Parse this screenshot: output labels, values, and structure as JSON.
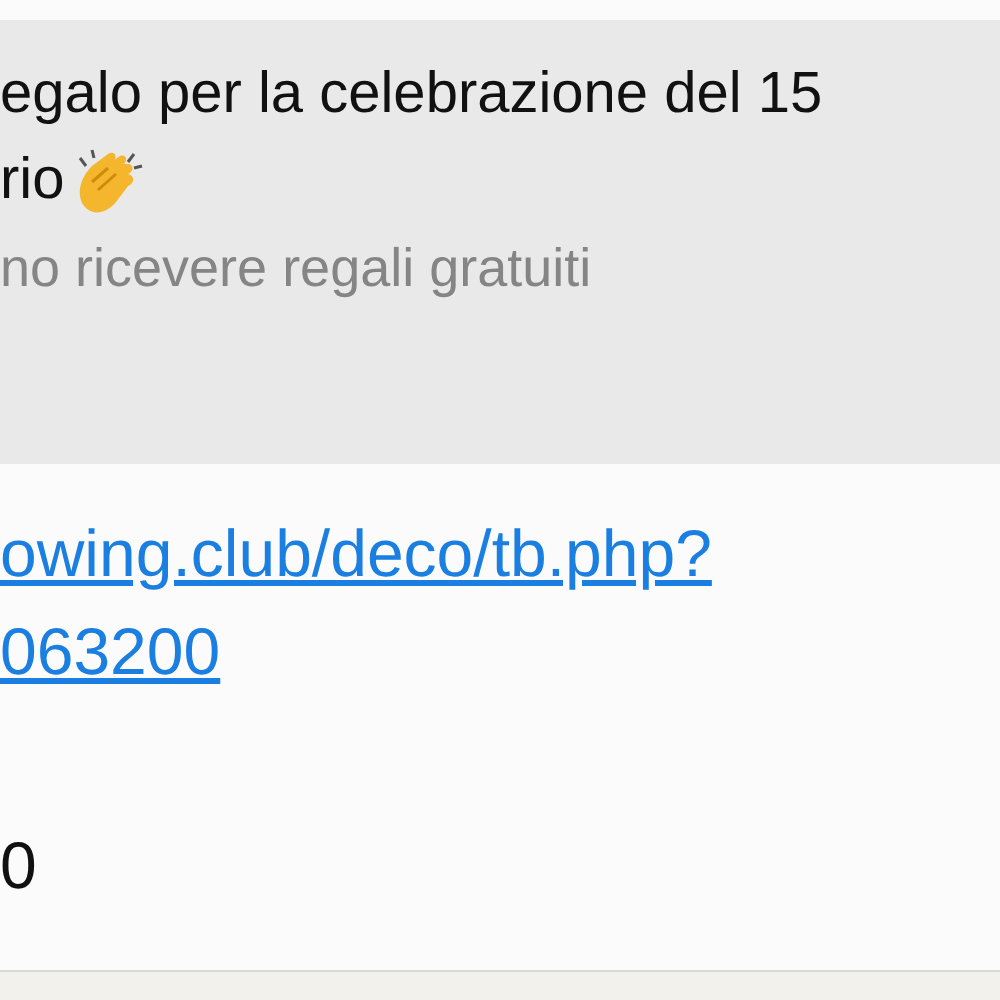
{
  "link_preview": {
    "title_lines": [
      "egalo per la celebrazione del 15",
      "rio"
    ],
    "description": "no ricevere regali gratuiti"
  },
  "message": {
    "link_lines": [
      "owing.club/deco/tb.php?",
      "063200"
    ],
    "trailing_text": "0"
  }
}
